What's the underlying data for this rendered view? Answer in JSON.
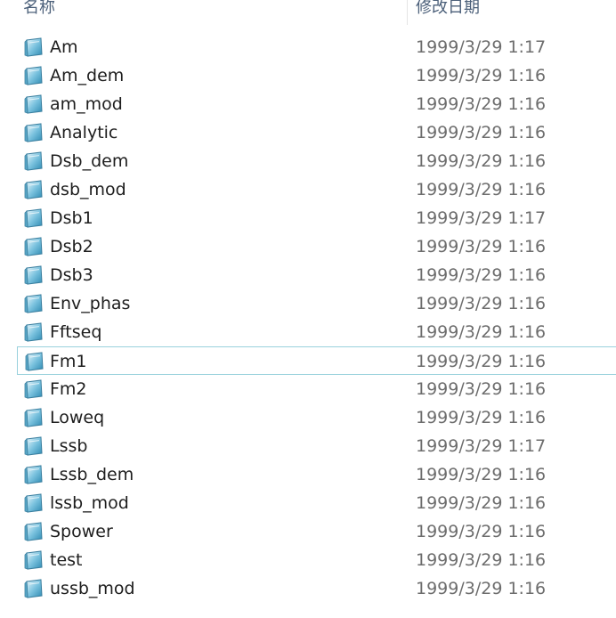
{
  "header": {
    "name_label": "名称",
    "date_label": "修改日期"
  },
  "colors": {
    "header_text": "#4c607a",
    "name_text": "#1e1e1e",
    "date_text": "#6d6d6d",
    "focus_border": "#99d1dc",
    "icon_fill": "#4aa3c8"
  },
  "icon": "matlab-figure-file-icon",
  "files": [
    {
      "name": "Am",
      "date": "1999/3/29 1:17"
    },
    {
      "name": "Am_dem",
      "date": "1999/3/29 1:16"
    },
    {
      "name": "am_mod",
      "date": "1999/3/29 1:16"
    },
    {
      "name": "Analytic",
      "date": "1999/3/29 1:16"
    },
    {
      "name": "Dsb_dem",
      "date": "1999/3/29 1:16"
    },
    {
      "name": "dsb_mod",
      "date": "1999/3/29 1:16"
    },
    {
      "name": "Dsb1",
      "date": "1999/3/29 1:17"
    },
    {
      "name": "Dsb2",
      "date": "1999/3/29 1:16"
    },
    {
      "name": "Dsb3",
      "date": "1999/3/29 1:16"
    },
    {
      "name": "Env_phas",
      "date": "1999/3/29 1:16"
    },
    {
      "name": "Fftseq",
      "date": "1999/3/29 1:16"
    },
    {
      "name": "Fm1",
      "date": "1999/3/29 1:16",
      "focused": true
    },
    {
      "name": "Fm2",
      "date": "1999/3/29 1:16"
    },
    {
      "name": "Loweq",
      "date": "1999/3/29 1:16"
    },
    {
      "name": "Lssb",
      "date": "1999/3/29 1:17"
    },
    {
      "name": "Lssb_dem",
      "date": "1999/3/29 1:16"
    },
    {
      "name": "lssb_mod",
      "date": "1999/3/29 1:16"
    },
    {
      "name": "Spower",
      "date": "1999/3/29 1:16"
    },
    {
      "name": "test",
      "date": "1999/3/29 1:16"
    },
    {
      "name": "ussb_mod",
      "date": "1999/3/29 1:16"
    }
  ]
}
